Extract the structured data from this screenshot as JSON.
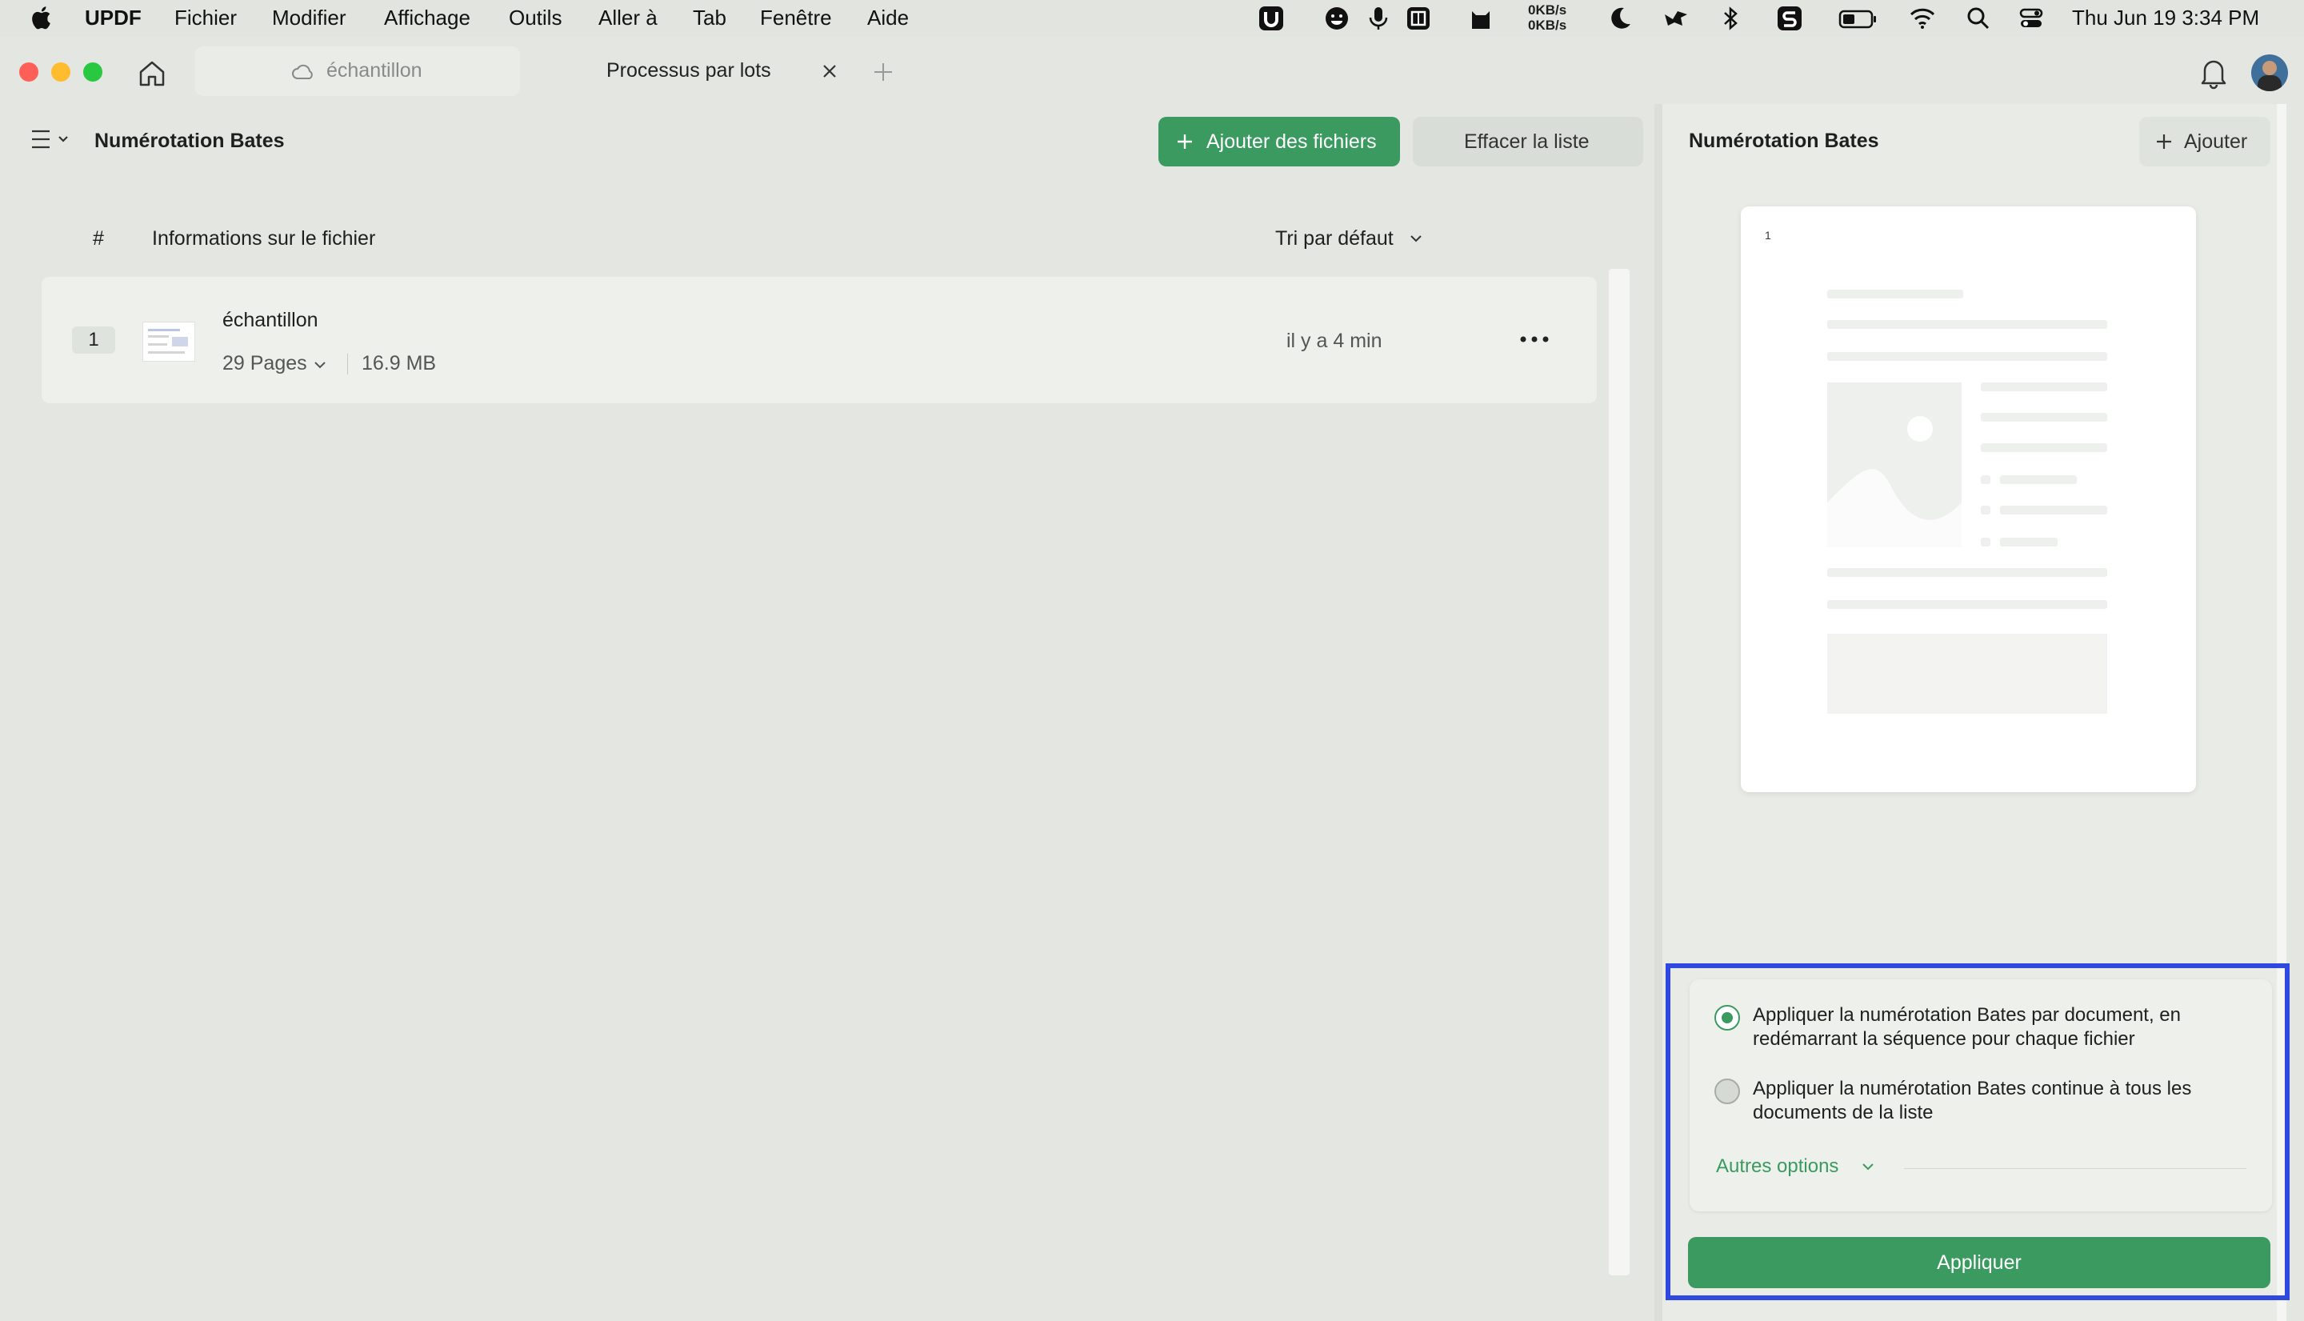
{
  "menubar": {
    "app_name": "UPDF",
    "items": [
      "Fichier",
      "Modifier",
      "Affichage",
      "Outils",
      "Aller à",
      "Tab",
      "Fenêtre",
      "Aide"
    ],
    "net_up": "0KB/s",
    "net_down": "0KB/s",
    "clock": "Thu Jun 19  3:34 PM"
  },
  "tabs": [
    {
      "label": "échantillon",
      "active": false
    },
    {
      "label": "Processus par lots",
      "active": true
    }
  ],
  "left": {
    "title": "Numérotation Bates",
    "add_files_label": "Ajouter des fichiers",
    "clear_list_label": "Effacer la liste",
    "col_index": "#",
    "col_info": "Informations sur le fichier",
    "sort_label": "Tri par défaut",
    "files": [
      {
        "index": "1",
        "name": "échantillon",
        "pages": "29 Pages",
        "size": "16.9 MB",
        "time": "il y a 4 min"
      }
    ]
  },
  "right": {
    "title": "Numérotation Bates",
    "add_label": "Ajouter",
    "preview_page_number": "1",
    "option_per_document": "Appliquer la numérotation Bates par document, en redémarrant la séquence pour chaque fichier",
    "option_continuous": "Appliquer la numérotation Bates continue à tous les documents de la liste",
    "selected_option": "per_document",
    "more_options_label": "Autres options",
    "apply_label": "Appliquer"
  },
  "colors": {
    "accent_green": "#3a9a5f",
    "highlight_blue": "#2f48e0",
    "close_red": "#fe5f57",
    "minimize_yellow": "#febc2e",
    "maximize_green": "#28c840"
  }
}
